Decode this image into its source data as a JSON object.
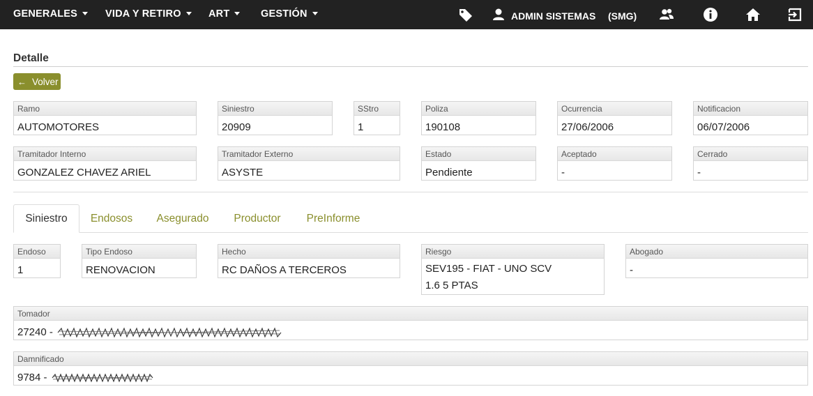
{
  "nav": {
    "menus": [
      "GENERALES",
      "VIDA Y RETIRO",
      "ART",
      "GESTIÓN"
    ],
    "user_name": "ADMIN SISTEMAS",
    "user_company": "(SMG)",
    "icons": [
      "tag-icon",
      "user-icon",
      "users-icon",
      "info-icon",
      "home-icon",
      "logout-icon"
    ]
  },
  "detail": {
    "title": "Detalle",
    "back_label": "Volver"
  },
  "summary": {
    "ramo": {
      "label": "Ramo",
      "value": "AUTOMOTORES"
    },
    "siniestro": {
      "label": "Siniestro",
      "value": "20909"
    },
    "sstro": {
      "label": "SStro",
      "value": "1"
    },
    "poliza": {
      "label": "Poliza",
      "value": "190108"
    },
    "ocurrencia": {
      "label": "Ocurrencia",
      "value": "27/06/2006"
    },
    "notificacion": {
      "label": "Notificacion",
      "value": "06/07/2006"
    },
    "tramitador_interno": {
      "label": "Tramitador Interno",
      "value": "GONZALEZ CHAVEZ ARIEL"
    },
    "tramitador_externo": {
      "label": "Tramitador Externo",
      "value": "ASYSTE"
    },
    "estado": {
      "label": "Estado",
      "value": "Pendiente"
    },
    "aceptado": {
      "label": "Aceptado",
      "value": "-"
    },
    "cerrado": {
      "label": "Cerrado",
      "value": "-"
    }
  },
  "tabs": [
    "Siniestro",
    "Endosos",
    "Asegurado",
    "Productor",
    "PreInforme"
  ],
  "siniestro_tab": {
    "endoso": {
      "label": "Endoso",
      "value": "1"
    },
    "tipo_endoso": {
      "label": "Tipo Endoso",
      "value": "RENOVACION"
    },
    "hecho": {
      "label": "Hecho",
      "value": "RC DAÑOS A TERCEROS"
    },
    "riesgo": {
      "label": "Riesgo",
      "value": "SEV195 - FIAT - UNO SCV 1.6 5 PTAS"
    },
    "abogado": {
      "label": "Abogado",
      "value": "-"
    },
    "tomador": {
      "label": "Tomador",
      "value": "27240 -"
    },
    "damnificado": {
      "label": "Damnificado",
      "value": "9784 -"
    }
  },
  "colors": {
    "navbar": "#222222",
    "accent": "#8a8f2d"
  }
}
